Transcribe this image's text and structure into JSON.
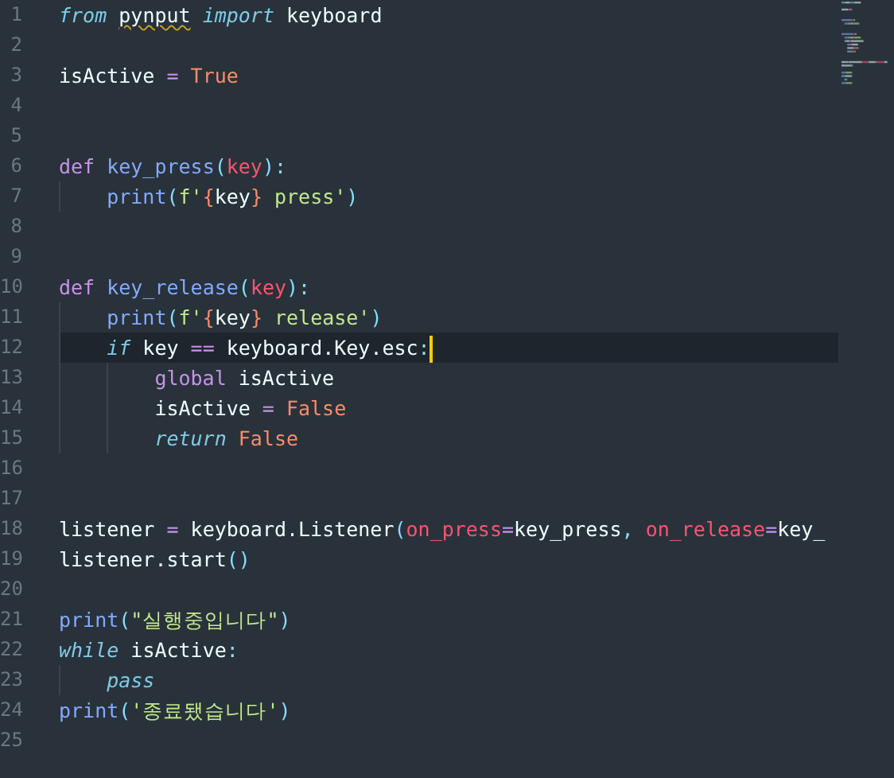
{
  "editor": {
    "lines": [
      {
        "number": "1",
        "selected": false,
        "tokens": [
          {
            "kind": "keyword",
            "text": "from "
          },
          {
            "kind": "unresolved",
            "text": "pynput"
          },
          {
            "kind": "keyword",
            "text": " import"
          },
          {
            "kind": "plain",
            "text": " keyboard"
          }
        ]
      },
      {
        "number": "2",
        "selected": false
      },
      {
        "number": "3",
        "selected": false,
        "tokens": [
          {
            "kind": "plain",
            "text": "isActive "
          },
          {
            "kind": "operator",
            "text": "= "
          },
          {
            "kind": "constant",
            "text": "True"
          }
        ]
      },
      {
        "number": "4",
        "selected": false
      },
      {
        "number": "5",
        "selected": false
      },
      {
        "number": "6",
        "selected": false,
        "tokens": [
          {
            "kind": "storage",
            "text": "def "
          },
          {
            "kind": "function",
            "text": "key_press"
          },
          {
            "kind": "punctuation",
            "text": "("
          },
          {
            "kind": "parameter",
            "text": "key"
          },
          {
            "kind": "punctuation",
            "text": "):"
          }
        ]
      },
      {
        "number": "7",
        "selected": false,
        "tokens": [
          {
            "kind": "indent"
          },
          {
            "kind": "function",
            "text": "print"
          },
          {
            "kind": "punctuation",
            "text": "("
          },
          {
            "kind": "string",
            "text": "f'"
          },
          {
            "kind": "brace",
            "text": "{"
          },
          {
            "kind": "plain",
            "text": "key"
          },
          {
            "kind": "brace",
            "text": "}"
          },
          {
            "kind": "string",
            "text": " press'"
          },
          {
            "kind": "punctuation",
            "text": ")"
          }
        ]
      },
      {
        "number": "8",
        "selected": false
      },
      {
        "number": "9",
        "selected": false
      },
      {
        "number": "10",
        "selected": false,
        "tokens": [
          {
            "kind": "storage",
            "text": "def "
          },
          {
            "kind": "function",
            "text": "key_release"
          },
          {
            "kind": "punctuation",
            "text": "("
          },
          {
            "kind": "parameter",
            "text": "key"
          },
          {
            "kind": "punctuation",
            "text": "):"
          }
        ]
      },
      {
        "number": "11",
        "selected": false,
        "tokens": [
          {
            "kind": "indent"
          },
          {
            "kind": "function",
            "text": "print"
          },
          {
            "kind": "punctuation",
            "text": "("
          },
          {
            "kind": "string",
            "text": "f'"
          },
          {
            "kind": "brace",
            "text": "{"
          },
          {
            "kind": "plain",
            "text": "key"
          },
          {
            "kind": "brace",
            "text": "}"
          },
          {
            "kind": "string",
            "text": " release'"
          },
          {
            "kind": "punctuation",
            "text": ")"
          }
        ]
      },
      {
        "number": "12",
        "selected": true,
        "tokens": [
          {
            "kind": "indent"
          },
          {
            "kind": "keyword",
            "text": "if"
          },
          {
            "kind": "plain",
            "text": " key "
          },
          {
            "kind": "operator",
            "text": "=="
          },
          {
            "kind": "plain",
            "text": " keyboard.Key.esc"
          },
          {
            "kind": "punctuation",
            "text": ":"
          }
        ]
      },
      {
        "number": "13",
        "selected": false,
        "tokens": [
          {
            "kind": "indent"
          },
          {
            "kind": "indent"
          },
          {
            "kind": "storage",
            "text": "global"
          },
          {
            "kind": "plain",
            "text": " isActive"
          }
        ]
      },
      {
        "number": "14",
        "selected": false,
        "tokens": [
          {
            "kind": "indent"
          },
          {
            "kind": "indent"
          },
          {
            "kind": "plain",
            "text": "isActive "
          },
          {
            "kind": "operator",
            "text": "= "
          },
          {
            "kind": "constant",
            "text": "False"
          }
        ]
      },
      {
        "number": "15",
        "selected": false,
        "tokens": [
          {
            "kind": "indent"
          },
          {
            "kind": "indent"
          },
          {
            "kind": "keyword",
            "text": "return "
          },
          {
            "kind": "constant",
            "text": "False"
          }
        ]
      },
      {
        "number": "16",
        "selected": false
      },
      {
        "number": "17",
        "selected": false
      },
      {
        "number": "18",
        "selected": false,
        "tokens": [
          {
            "kind": "plain",
            "text": "listener "
          },
          {
            "kind": "operator",
            "text": "="
          },
          {
            "kind": "plain",
            "text": " keyboard.Listener"
          },
          {
            "kind": "punctuation",
            "text": "("
          },
          {
            "kind": "parameter",
            "text": "on_press"
          },
          {
            "kind": "operator",
            "text": "="
          },
          {
            "kind": "plain",
            "text": "key_press"
          },
          {
            "kind": "punctuation",
            "text": ", "
          },
          {
            "kind": "parameter",
            "text": "on_release"
          },
          {
            "kind": "operator",
            "text": "="
          },
          {
            "kind": "plain",
            "text": "key_"
          }
        ]
      },
      {
        "number": "19",
        "selected": false,
        "tokens": [
          {
            "kind": "plain",
            "text": "listener.start"
          },
          {
            "kind": "punctuation",
            "text": "()"
          }
        ]
      },
      {
        "number": "20",
        "selected": false
      },
      {
        "number": "21",
        "selected": false,
        "tokens": [
          {
            "kind": "function",
            "text": "print"
          },
          {
            "kind": "punctuation",
            "text": "("
          },
          {
            "kind": "string",
            "text": "\"실행중입니다\""
          },
          {
            "kind": "punctuation",
            "text": ")"
          }
        ]
      },
      {
        "number": "22",
        "selected": false,
        "tokens": [
          {
            "kind": "keyword",
            "text": "while"
          },
          {
            "kind": "plain",
            "text": " isActive"
          },
          {
            "kind": "punctuation",
            "text": ":"
          }
        ]
      },
      {
        "number": "23",
        "selected": false,
        "tokens": [
          {
            "kind": "indent"
          },
          {
            "kind": "keyword",
            "text": "pass"
          }
        ]
      },
      {
        "number": "24",
        "selected": false,
        "tokens": [
          {
            "kind": "function",
            "text": "print"
          },
          {
            "kind": "punctuation",
            "text": "("
          },
          {
            "kind": "string",
            "text": "'종료됐습니다'"
          },
          {
            "kind": "punctuation",
            "text": ")"
          }
        ]
      },
      {
        "number": "25",
        "selected": false
      }
    ]
  }
}
